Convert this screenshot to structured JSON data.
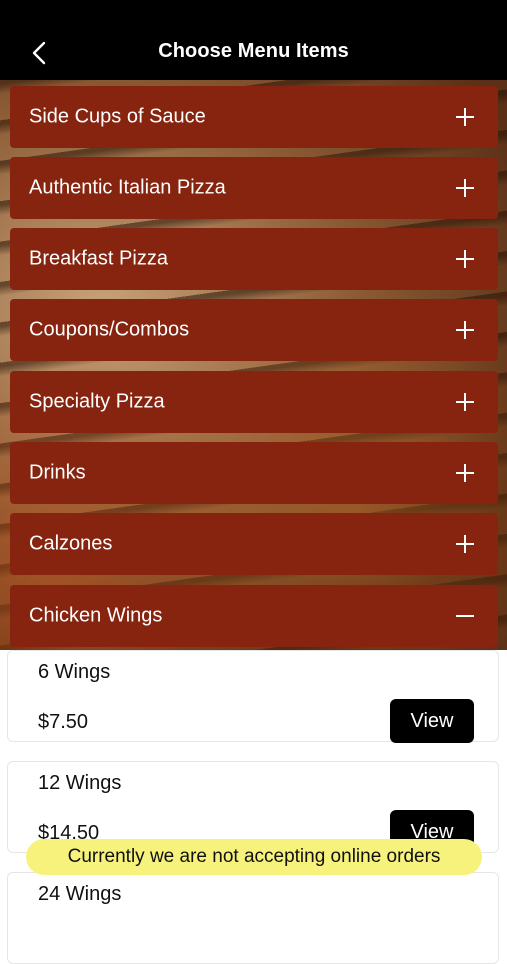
{
  "header": {
    "title": "Choose Menu Items",
    "back_icon": "chevron-left-icon"
  },
  "categories": [
    {
      "label": "Side Cups of Sauce",
      "expanded": false
    },
    {
      "label": "Authentic Italian Pizza",
      "expanded": false
    },
    {
      "label": "Breakfast Pizza",
      "expanded": false
    },
    {
      "label": "Coupons/Combos",
      "expanded": false
    },
    {
      "label": "Specialty Pizza",
      "expanded": false
    },
    {
      "label": "Drinks",
      "expanded": false
    },
    {
      "label": "Calzones",
      "expanded": false
    },
    {
      "label": "Chicken Wings",
      "expanded": true
    }
  ],
  "items": [
    {
      "name": "6 Wings",
      "price": "$7.50",
      "button": "View"
    },
    {
      "name": "12 Wings",
      "price": "$14.50",
      "button": "View"
    },
    {
      "name": "24 Wings"
    }
  ],
  "banner": "Currently we are not accepting online orders",
  "colors": {
    "header": "#000000",
    "category": "#862410",
    "banner": "#f6f27c",
    "button": "#000000"
  }
}
